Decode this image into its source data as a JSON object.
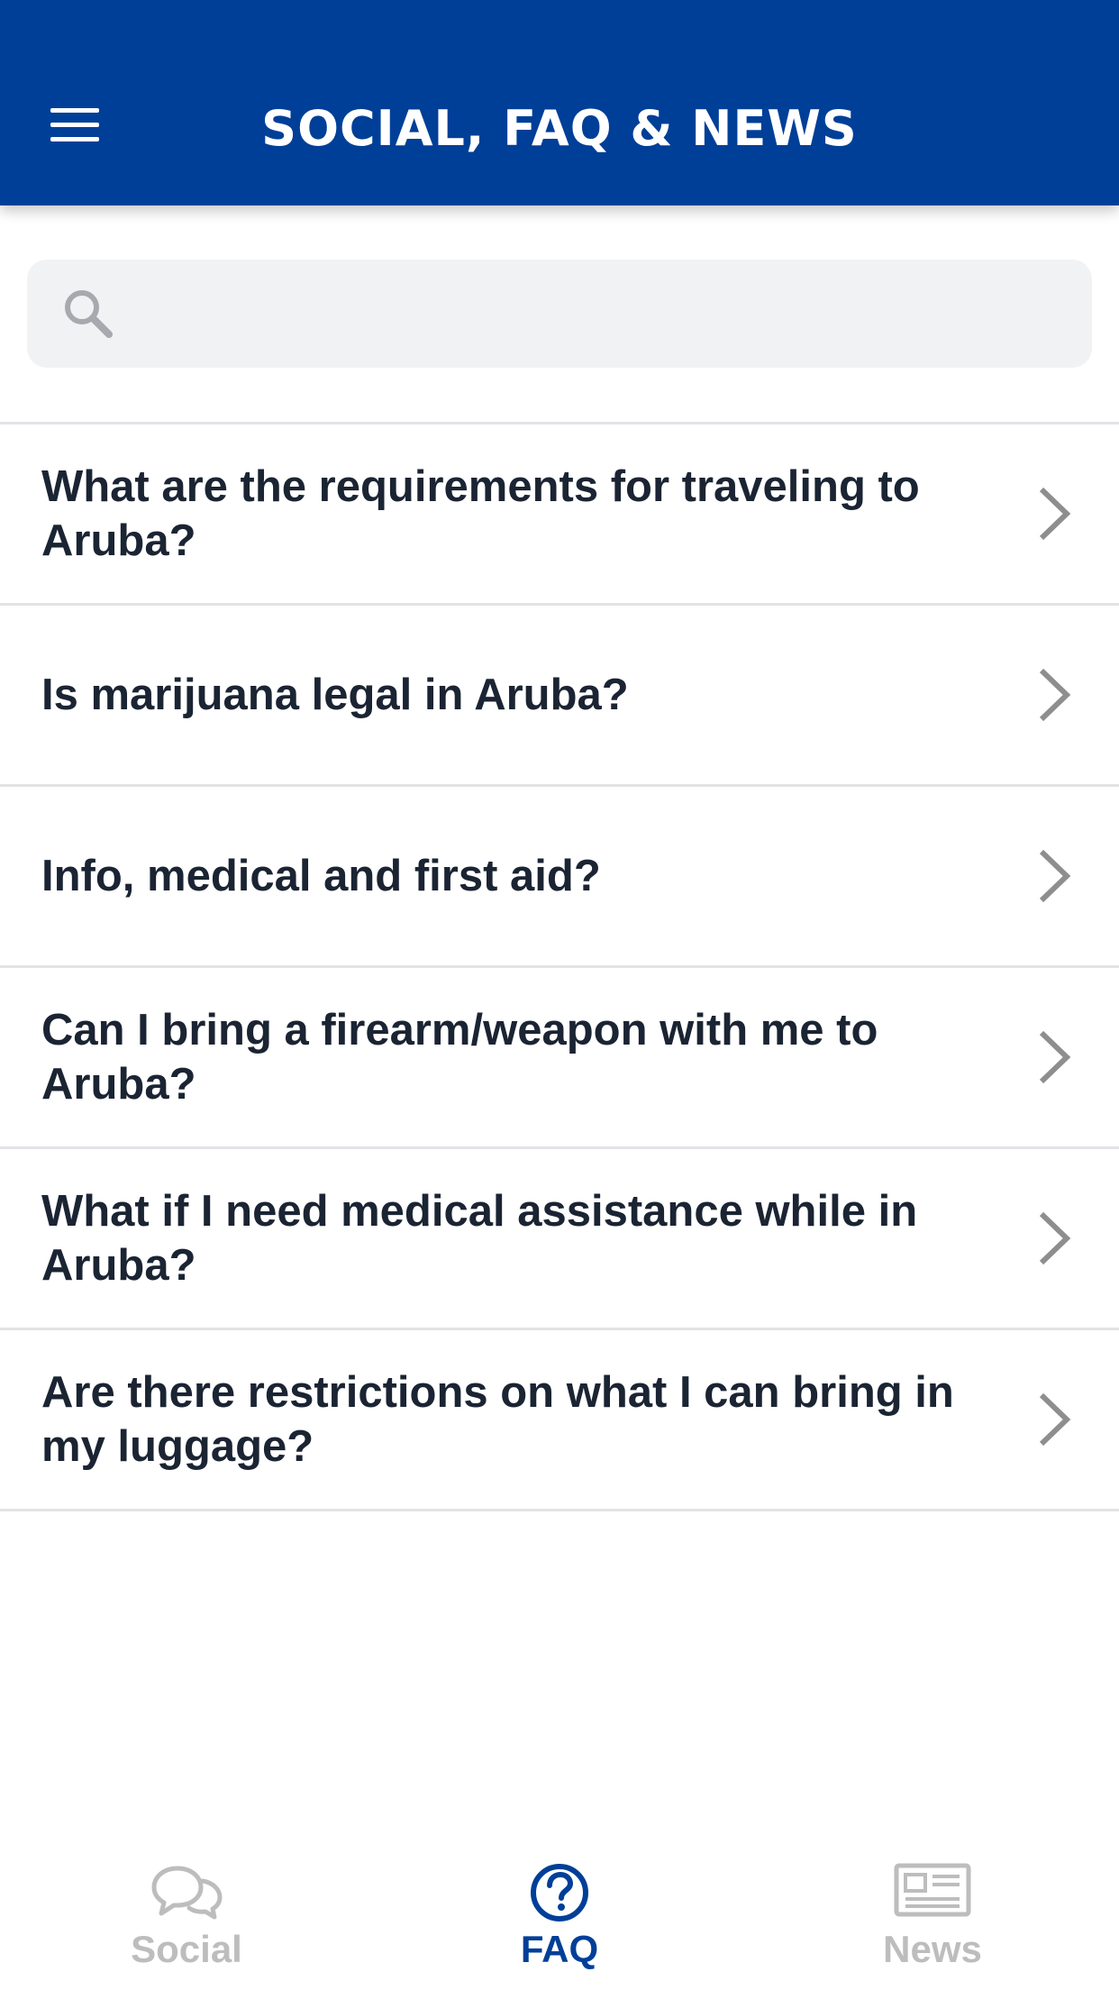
{
  "header": {
    "title": "SOCIAL, FAQ & NEWS",
    "background_color": "#003F98",
    "menu_icon": "hamburger-menu-icon"
  },
  "search": {
    "placeholder": "",
    "value": "",
    "icon": "search-icon"
  },
  "faq": {
    "items": [
      {
        "question": "What are the requirements for traveling to Aruba?"
      },
      {
        "question": "Is marijuana legal in Aruba?"
      },
      {
        "question": "Info, medical and first aid?"
      },
      {
        "question": "Can I bring a firearm/weapon with me to Aruba?"
      },
      {
        "question": "What if I need medical assistance while in Aruba?"
      },
      {
        "question": "Are there restrictions on what I can bring in my luggage?"
      }
    ],
    "chevron_icon": "chevron-right-icon"
  },
  "tabbar": {
    "tabs": [
      {
        "label": "Social",
        "icon": "chat-bubbles-icon",
        "active": false
      },
      {
        "label": "FAQ",
        "icon": "question-circle-icon",
        "active": true
      },
      {
        "label": "News",
        "icon": "newspaper-icon",
        "active": false
      }
    ],
    "active_color": "#003F98",
    "inactive_color": "#BDBDBD"
  }
}
